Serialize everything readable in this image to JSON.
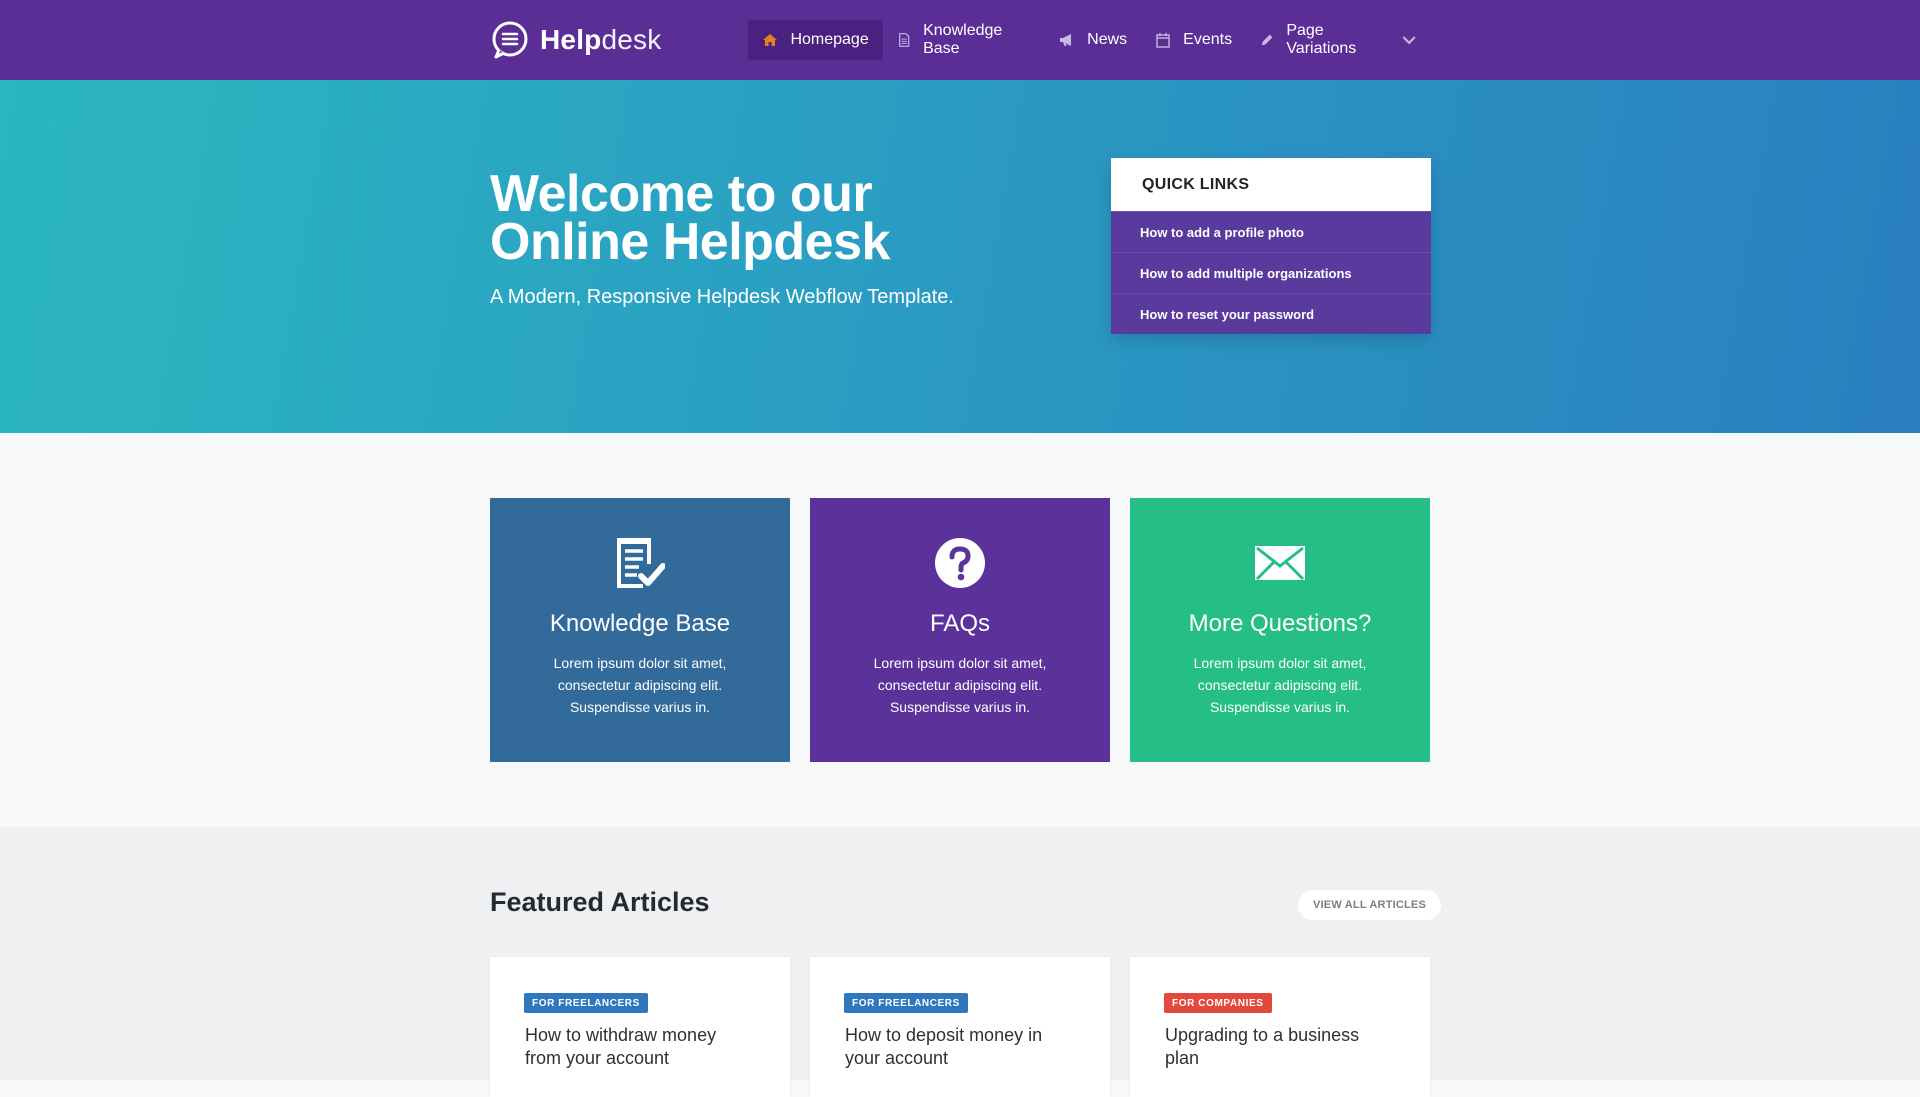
{
  "nav": {
    "brand_bold": "Help",
    "brand_light": "desk",
    "items": [
      {
        "label": "Homepage",
        "icon": "home-icon"
      },
      {
        "label": "Knowledge Base",
        "icon": "document-icon"
      },
      {
        "label": "News",
        "icon": "megaphone-icon"
      },
      {
        "label": "Events",
        "icon": "calendar-icon"
      },
      {
        "label": "Page Variations",
        "icon": "pencil-icon"
      }
    ]
  },
  "hero": {
    "title": "Welcome to our Online Helpdesk",
    "subtitle": "A Modern, Responsive Helpdesk Webflow Template."
  },
  "quick_links": {
    "title": "QUICK LINKS",
    "items": [
      "How to add a profile photo",
      "How to add multiple organizations",
      "How to reset your password"
    ]
  },
  "features": [
    {
      "title": "Knowledge Base",
      "text": "Lorem ipsum dolor sit amet, consectetur adipiscing elit. Suspendisse varius in.",
      "icon": "checklist-icon",
      "color": "#326a9a"
    },
    {
      "title": "FAQs",
      "text": "Lorem ipsum dolor sit amet, consectetur adipiscing elit. Suspendisse varius in.",
      "icon": "question-icon",
      "color": "#5b3299"
    },
    {
      "title": "More Questions?",
      "text": "Lorem ipsum dolor sit amet, consectetur adipiscing elit. Suspendisse varius in.",
      "icon": "envelope-icon",
      "color": "#24be86"
    }
  ],
  "articles": {
    "title": "Featured Articles",
    "view_all": "VIEW ALL ARTICLES",
    "items": [
      {
        "tag": "FOR FREELANCERS",
        "title": "How to withdraw money from your account"
      },
      {
        "tag": "FOR FREELANCERS",
        "title": "How to deposit money in your account"
      },
      {
        "tag": "FOR COMPANIES",
        "title": "Upgrading to a business plan"
      }
    ]
  },
  "colors": {
    "nav": "#5b2e95",
    "accent_orange": "#e67e22",
    "tag_blue": "#2f77bd",
    "tag_red": "#e2493c"
  }
}
